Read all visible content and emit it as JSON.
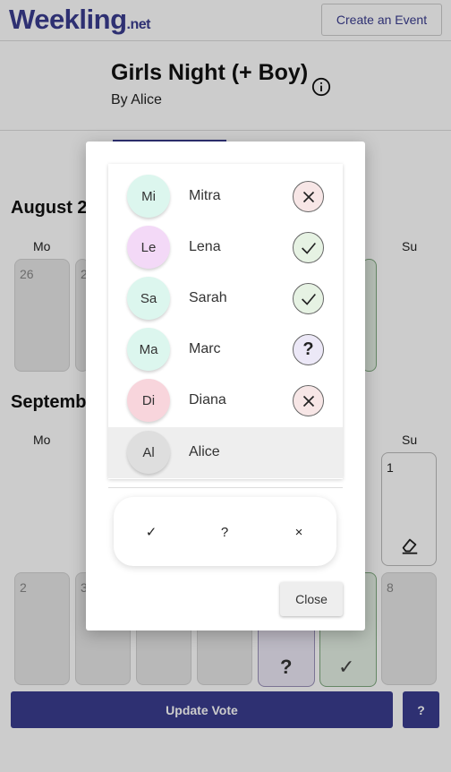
{
  "header": {
    "logo_main": "Weekling",
    "logo_suffix": ".net",
    "create_event_label": "Create an Event"
  },
  "event": {
    "title": "Girls Night (+ Boy)",
    "author": "By Alice"
  },
  "calendar": {
    "month1_label": "August 2",
    "month2_label": "Septemb",
    "weekday_mo": "Mo",
    "weekday_su": "Su",
    "aug_days": [
      "26",
      "2"
    ],
    "sep_day_1": "1",
    "sep_days_row": [
      "2",
      "3",
      "8"
    ],
    "question_mark": "?",
    "check_mark": "✓"
  },
  "footer": {
    "update_vote_label": "Update Vote",
    "help_label": "?"
  },
  "modal": {
    "participants": [
      {
        "initials": "Mi",
        "name": "Mitra",
        "vote": "no",
        "avatar_color": "#dcf6ee",
        "vote_color": "#f7e6e6"
      },
      {
        "initials": "Le",
        "name": "Lena",
        "vote": "yes",
        "avatar_color": "#f3d9f7",
        "vote_color": "#e6f2e3"
      },
      {
        "initials": "Sa",
        "name": "Sarah",
        "vote": "yes",
        "avatar_color": "#dcf6ee",
        "vote_color": "#e6f2e3"
      },
      {
        "initials": "Ma",
        "name": "Marc",
        "vote": "maybe",
        "avatar_color": "#dcf6ee",
        "vote_color": "#ece8f7"
      },
      {
        "initials": "Di",
        "name": "Diana",
        "vote": "no",
        "avatar_color": "#f8d5dc",
        "vote_color": "#f7e6e6"
      },
      {
        "initials": "Al",
        "name": "Alice",
        "vote": "",
        "avatar_color": "#dedede",
        "vote_color": ""
      }
    ],
    "vote_options": {
      "yes": "✓",
      "maybe": "?",
      "no": "×"
    },
    "close_label": "Close"
  }
}
